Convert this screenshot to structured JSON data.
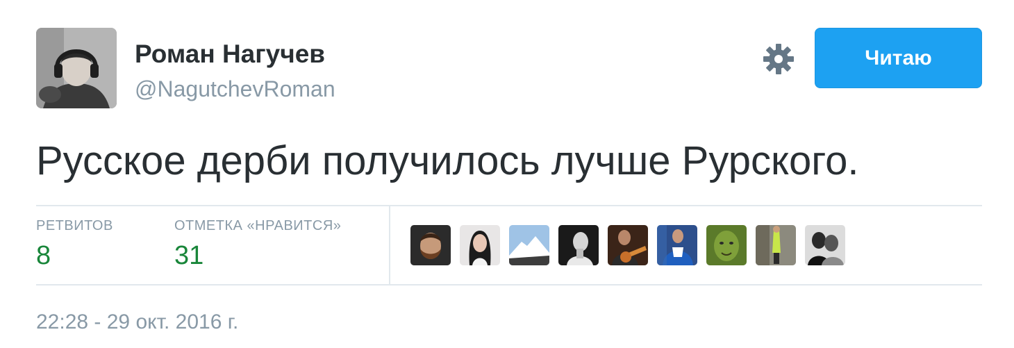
{
  "author": {
    "display_name": "Роман Нагучев",
    "handle": "@NagutchevRoman"
  },
  "header": {
    "settings_icon": "gear-icon",
    "follow_label": "Читаю",
    "follow_color": "#1da1f2"
  },
  "tweet": {
    "text": "Русское дерби получилось лучше Рурского.",
    "timestamp": "22:28 - 29 окт. 2016 г."
  },
  "stats": {
    "retweets_label": "РЕТВИТОВ",
    "retweets_count": "8",
    "likes_label": "ОТМЕТКА «НРАВИТСЯ»",
    "likes_count": "31",
    "count_color": "#19863a"
  },
  "likers": [
    {
      "icon": "avatar-bearded-man"
    },
    {
      "icon": "avatar-woman"
    },
    {
      "icon": "avatar-mountain"
    },
    {
      "icon": "avatar-man-bw"
    },
    {
      "icon": "avatar-guitarist"
    },
    {
      "icon": "avatar-football-player"
    },
    {
      "icon": "avatar-green-face"
    },
    {
      "icon": "avatar-cyclist"
    },
    {
      "icon": "avatar-couple-bw"
    }
  ]
}
